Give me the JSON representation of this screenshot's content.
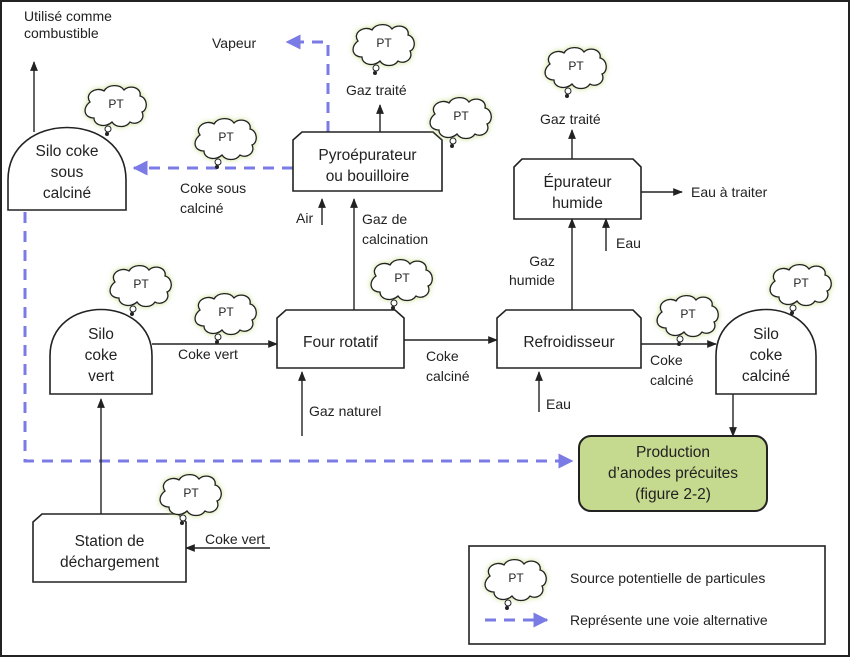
{
  "diagram": {
    "nodes": {
      "silo_sous_calcine": "Silo coke\nsous\ncalciné",
      "pyro": "Pyroépurateur\nou bouilloire",
      "epurateur": "Épurateur\nhumide",
      "silo_vert": "Silo\ncoke\nvert",
      "four": "Four rotatif",
      "refroidisseur": "Refroidisseur",
      "silo_calcine": "Silo\ncoke\ncalciné",
      "production": "Production\nd’anodes précuites\n(figure 2-2)",
      "station": "Station de\ndéchargement"
    },
    "labels": {
      "utilise": "Utilisé comme\ncombustible",
      "vapeur": "Vapeur",
      "gaz_traite_1": "Gaz traité",
      "gaz_traite_2": "Gaz traité",
      "coke_sous_calcine": "Coke sous\ncalciné",
      "air": "Air",
      "gaz_calcination": "Gaz de\ncalcination",
      "eau_a_traiter": "Eau à traiter",
      "eau_1": "Eau",
      "gaz_humide": "Gaz\nhumide",
      "coke_vert_1": "Coke vert",
      "coke_calcine_1": "Coke\ncalciné",
      "coke_calcine_2": "Coke\ncalciné",
      "gaz_naturel": "Gaz naturel",
      "eau_2": "Eau",
      "coke_vert_2": "Coke vert"
    },
    "pt_label": "PT",
    "colors": {
      "alt_path": "#7b7be6",
      "production_fill": "#c5d98f",
      "pt_glow": "#b5d46a"
    }
  },
  "legend": {
    "pt_label": "PT",
    "source": "Source potentielle  de particules",
    "alternative": "Représente une voie alternative"
  }
}
